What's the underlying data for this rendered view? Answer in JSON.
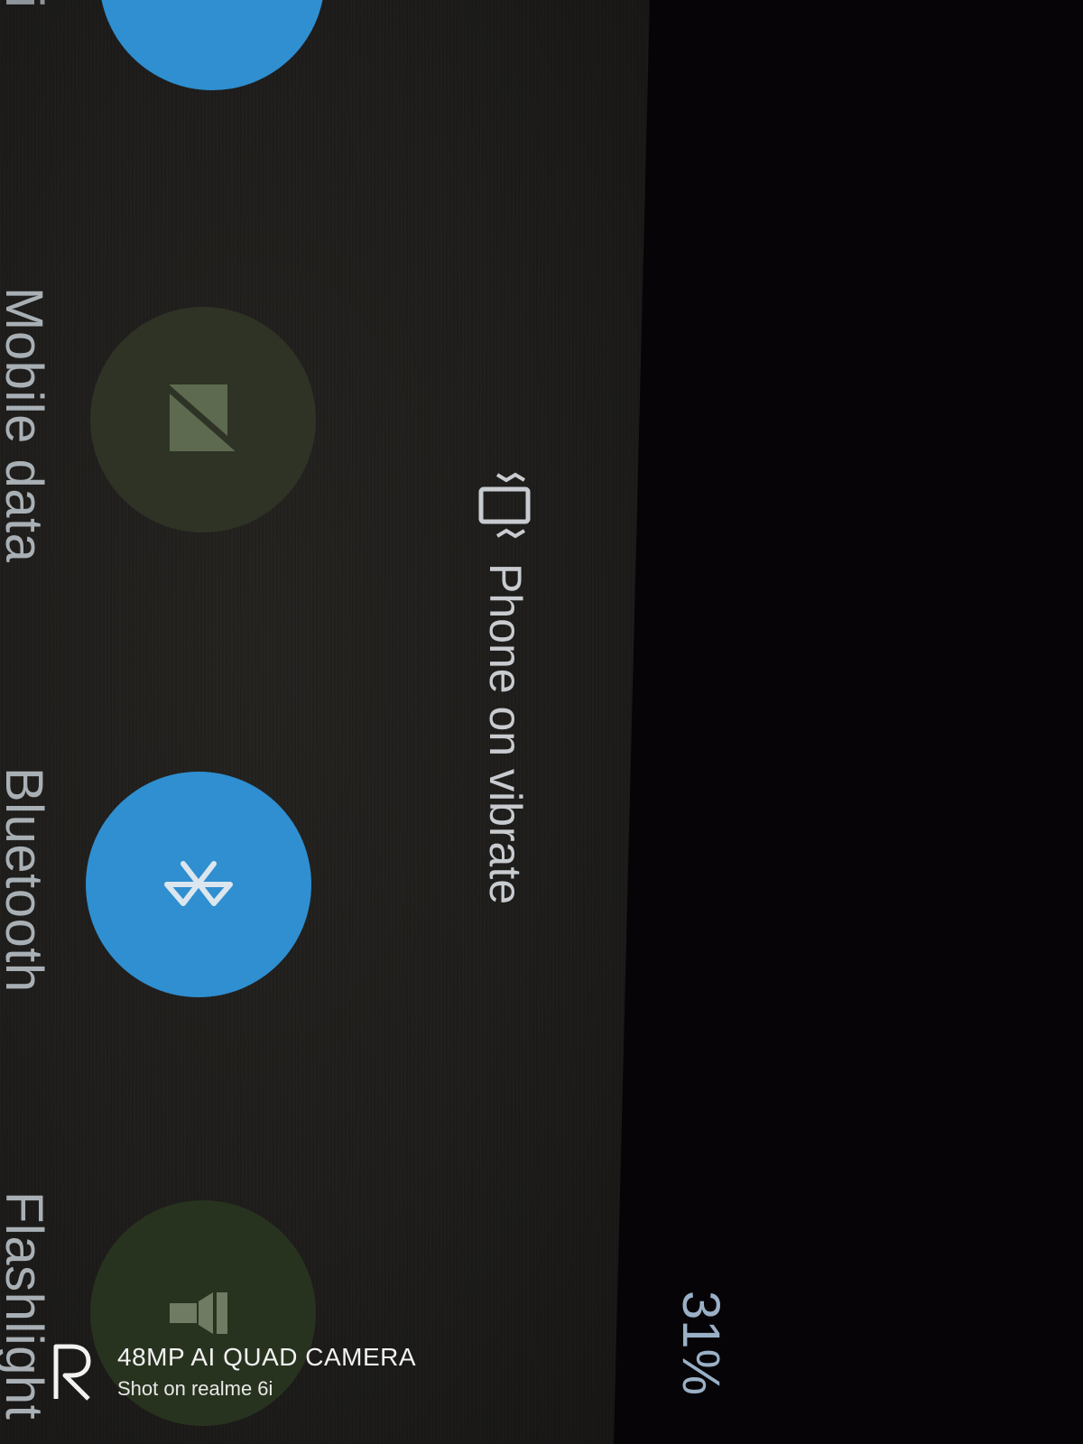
{
  "quick_settings": {
    "partial_label": "Fi",
    "tiles": [
      {
        "label": "Mobile data",
        "state": "off",
        "icon": "mobile-data-off-icon"
      },
      {
        "label": "Bluetooth",
        "state": "on",
        "icon": "bluetooth-icon"
      },
      {
        "label": "Flashlight",
        "state": "off",
        "icon": "flashlight-icon"
      }
    ],
    "vibrate_status": "Phone on vibrate",
    "battery": "31%"
  },
  "watermark": {
    "line1": "48MP AI QUAD CAMERA",
    "line2": "Shot on realme 6i"
  },
  "colors": {
    "tile_on": "#2f8fd0",
    "tile_off": "#2e3326",
    "screen_bg": "#1d1c1a",
    "background": "#060407"
  }
}
